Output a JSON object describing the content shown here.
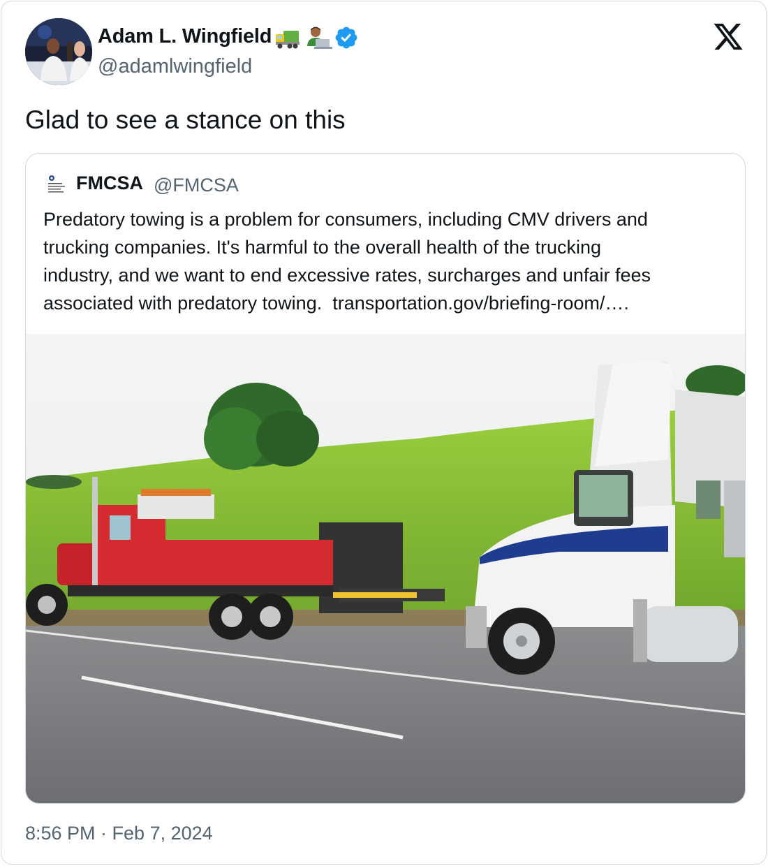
{
  "author": {
    "name": "Adam L. Wingfield",
    "handle": "@adamlwingfield",
    "emojis": [
      "truck-icon",
      "technologist-icon"
    ],
    "verified": true
  },
  "tweet": {
    "text": "Glad to see a stance on this",
    "timestamp": "8:56 PM · Feb 7, 2024"
  },
  "quote": {
    "name": "FMCSA",
    "handle": "@FMCSA",
    "lines": [
      "Predatory towing is a problem for consumers, including CMV drivers and",
      "trucking companies. It's harmful to the overall health of the trucking",
      "industry, and we want to end excessive rates, surcharges and unfair fees",
      "associated with predatory towing."
    ],
    "link": "transportation.gov/briefing-room/…."
  },
  "colors": {
    "text": "#0f1419",
    "secondary": "#536471",
    "border": "#cfd9de",
    "verified": "#1d9bf0"
  }
}
